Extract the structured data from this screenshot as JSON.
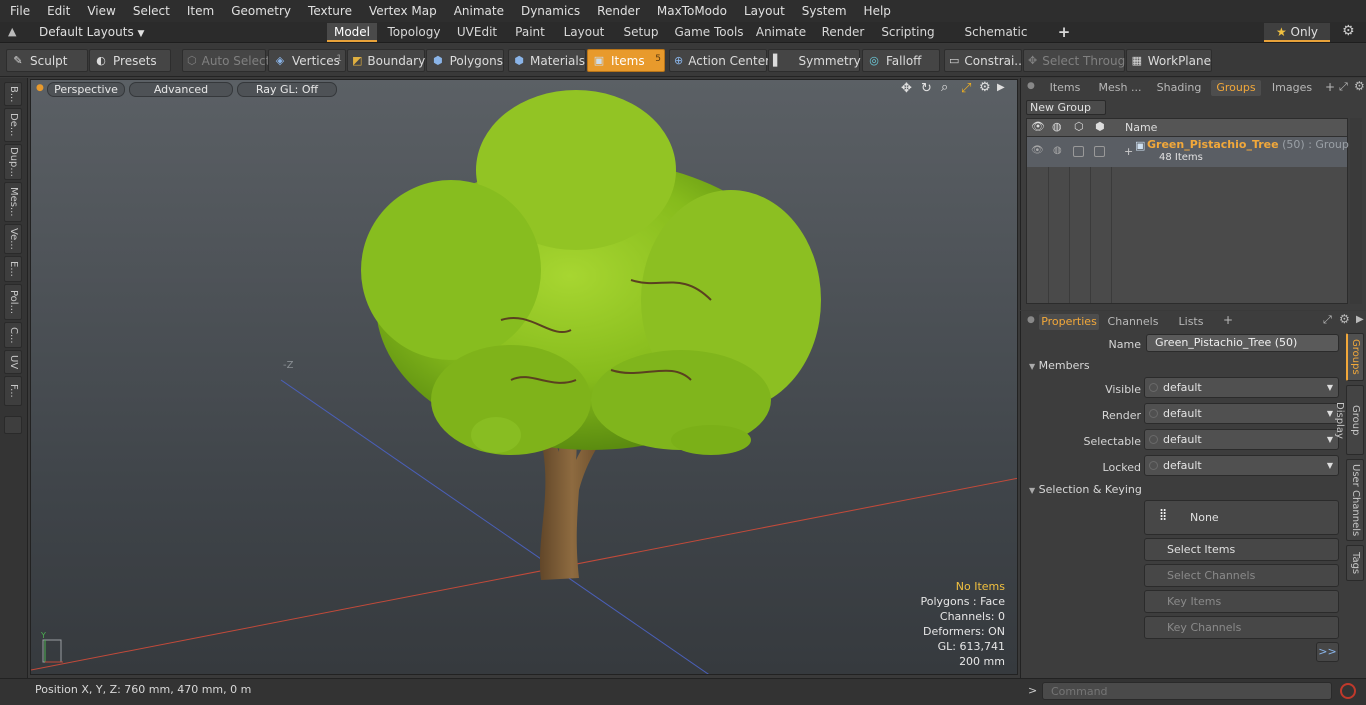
{
  "menu": [
    "File",
    "Edit",
    "View",
    "Select",
    "Item",
    "Geometry",
    "Texture",
    "Vertex Map",
    "Animate",
    "Dynamics",
    "Render",
    "MaxToModo",
    "Layout",
    "System",
    "Help"
  ],
  "layoutbar": {
    "layouts_dropdown": "Default Layouts",
    "tabs": [
      "Model",
      "Topology",
      "UVEdit",
      "Paint",
      "Layout",
      "Setup",
      "Game Tools",
      "Animate",
      "Render",
      "Scripting",
      "Schematic Fusion"
    ],
    "active_tab": "Model",
    "add_label": "+",
    "only_label": "Only"
  },
  "toolbar": {
    "sculpt": "Sculpt",
    "presets": "Presets",
    "auto_select": "Auto Select",
    "vertices": "Vertices",
    "vertices_count": "1",
    "boundary": "Boundary",
    "polygons": "Polygons",
    "materials": "Materials",
    "items": "Items",
    "items_count": "5",
    "action_center": "Action Center",
    "symmetry": "Symmetry",
    "falloff": "Falloff",
    "constraints": "Constrai...",
    "select_through": "Select Through",
    "workplane": "WorkPlane"
  },
  "left_tabs": [
    "B...",
    "De...",
    "Dup...",
    "Mes...",
    "Ve...",
    "E...",
    "Pol...",
    "C...",
    "UV",
    "F..."
  ],
  "viewport": {
    "perspective": "Perspective",
    "advanced": "Advanced",
    "raygl": "Ray GL: Off",
    "stats": {
      "selection": "No Items",
      "polygons": "Polygons : Face",
      "channels": "Channels: 0",
      "deformers": "Deformers: ON",
      "gl": "GL: 613,741",
      "scale": "200 mm"
    }
  },
  "statusbar": {
    "position": "Position X, Y, Z:   760 mm, 470 mm, 0 m"
  },
  "top_panel": {
    "tabs": [
      "Items",
      "Mesh ...",
      "Shading",
      "Groups",
      "Images"
    ],
    "active_tab": "Groups",
    "new_group": "New Group",
    "column_name": "Name",
    "group": {
      "name": "Green_Pistachio_Tree",
      "count": "(50)",
      "type": ": Group",
      "items": "48 Items"
    }
  },
  "bottom_panel": {
    "tabs": [
      "Properties",
      "Channels",
      "Lists"
    ],
    "active_tab": "Properties",
    "name_label": "Name",
    "name_value": "Green_Pistachio_Tree (50)",
    "members_section": "Members",
    "visible_label": "Visible",
    "render_label": "Render",
    "selectable_label": "Selectable",
    "locked_label": "Locked",
    "default_value": "default",
    "selection_section": "Selection & Keying",
    "none_label": "None",
    "select_items": "Select Items",
    "select_channels": "Select Channels",
    "key_items": "Key Items",
    "key_channels": "Key Channels",
    "more": ">>",
    "side_tabs": [
      "Groups",
      "Group Display",
      "User Channels",
      "Tags"
    ]
  },
  "command": {
    "placeholder": "Command",
    "prompt": ">"
  },
  "colors": {
    "accent": "#e89a2c",
    "selection_text": "#f0c040",
    "foliage": "#8dc21f",
    "trunk": "#7a5a34"
  }
}
